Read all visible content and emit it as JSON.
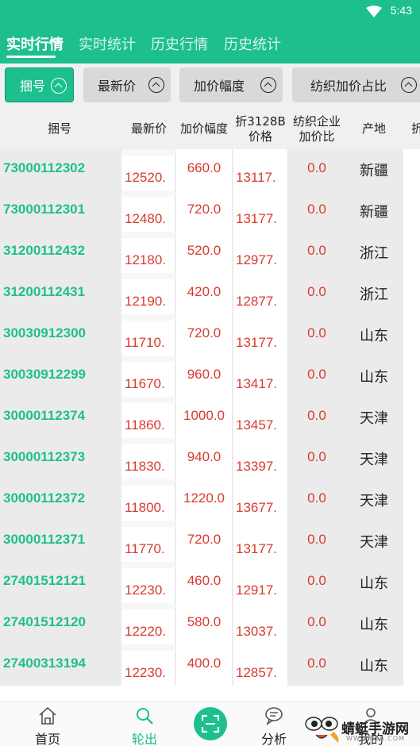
{
  "status_bar": {
    "time": "5:43"
  },
  "tabs": [
    {
      "label": "实时行情",
      "active": true
    },
    {
      "label": "实时统计",
      "active": false
    },
    {
      "label": "历史行情",
      "active": false
    },
    {
      "label": "历史统计",
      "active": false
    }
  ],
  "filters": [
    {
      "label": "捆号",
      "active": true
    },
    {
      "label": "最新价",
      "active": false
    },
    {
      "label": "加价幅度",
      "active": false
    },
    {
      "label": "纺织加价占比",
      "active": false
    }
  ],
  "columns": {
    "bale_no": "捆号",
    "latest_price": "最新价",
    "markup": "加价幅度",
    "converted_line1": "折3128B",
    "converted_line2": "价格",
    "ratio_line1": "纺织企业",
    "ratio_line2": "加价比",
    "origin": "产地",
    "extra": "折"
  },
  "rows": [
    {
      "bale_no": "73000112302",
      "latest_price": "12520.",
      "markup": "660.0",
      "converted": "13117.",
      "ratio": "0.0",
      "origin": "新疆"
    },
    {
      "bale_no": "73000112301",
      "latest_price": "12480.",
      "markup": "720.0",
      "converted": "13177.",
      "ratio": "0.0",
      "origin": "新疆"
    },
    {
      "bale_no": "31200112432",
      "latest_price": "12180.",
      "markup": "520.0",
      "converted": "12977.",
      "ratio": "0.0",
      "origin": "浙江"
    },
    {
      "bale_no": "31200112431",
      "latest_price": "12190.",
      "markup": "420.0",
      "converted": "12877.",
      "ratio": "0.0",
      "origin": "浙江"
    },
    {
      "bale_no": "30030912300",
      "latest_price": "11710.",
      "markup": "720.0",
      "converted": "13177.",
      "ratio": "0.0",
      "origin": "山东"
    },
    {
      "bale_no": "30030912299",
      "latest_price": "11670.",
      "markup": "960.0",
      "converted": "13417.",
      "ratio": "0.0",
      "origin": "山东"
    },
    {
      "bale_no": "30000112374",
      "latest_price": "11860.",
      "markup": "1000.0",
      "converted": "13457.",
      "ratio": "0.0",
      "origin": "天津"
    },
    {
      "bale_no": "30000112373",
      "latest_price": "11830.",
      "markup": "940.0",
      "converted": "13397.",
      "ratio": "0.0",
      "origin": "天津"
    },
    {
      "bale_no": "30000112372",
      "latest_price": "11800.",
      "markup": "1220.0",
      "converted": "13677.",
      "ratio": "0.0",
      "origin": "天津"
    },
    {
      "bale_no": "30000112371",
      "latest_price": "11770.",
      "markup": "720.0",
      "converted": "13177.",
      "ratio": "0.0",
      "origin": "天津"
    },
    {
      "bale_no": "27401512121",
      "latest_price": "12230.",
      "markup": "460.0",
      "converted": "12917.",
      "ratio": "0.0",
      "origin": "山东"
    },
    {
      "bale_no": "27401512120",
      "latest_price": "12220.",
      "markup": "580.0",
      "converted": "13037.",
      "ratio": "0.0",
      "origin": "山东"
    },
    {
      "bale_no": "27400313194",
      "latest_price": "12230.",
      "markup": "400.0",
      "converted": "12857.",
      "ratio": "0.0",
      "origin": "山东"
    }
  ],
  "bottom_nav": [
    {
      "label": "首页",
      "icon": "home-icon",
      "active": false
    },
    {
      "label": "轮出",
      "icon": "search-icon",
      "active": true
    },
    {
      "label": "分析",
      "icon": "chat-icon",
      "active": false
    },
    {
      "label": "我的",
      "icon": "user-icon",
      "active": false
    }
  ],
  "watermark": {
    "title": "蜻蜓手游网",
    "subtitle": "WWW.QT6.COM"
  },
  "colors": {
    "accent": "#1dbf8f",
    "price_red": "#d93a2e",
    "row_bg": "#ebebeb"
  }
}
